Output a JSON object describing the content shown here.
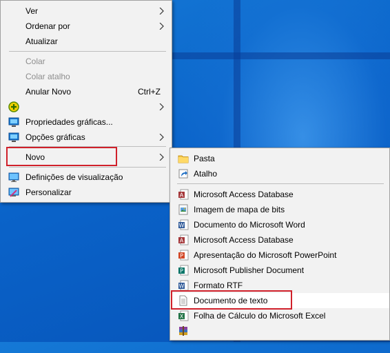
{
  "main_menu": {
    "items": [
      {
        "label": "Ver",
        "has_submenu": true
      },
      {
        "label": "Ordenar por",
        "has_submenu": true
      },
      {
        "label": "Atualizar"
      },
      {
        "label": "Colar",
        "disabled": true
      },
      {
        "label": "Colar atalho",
        "disabled": true
      },
      {
        "label": "Anular Novo",
        "shortcut": "Ctrl+Z"
      },
      {
        "label": "",
        "icon": "graphics-plus-icon",
        "has_submenu": true
      },
      {
        "label": "Propriedades gráficas...",
        "icon": "graphics-properties-icon"
      },
      {
        "label": "Opções gráficas",
        "icon": "graphics-options-icon",
        "has_submenu": true
      },
      {
        "label": "Novo",
        "has_submenu": true,
        "highlighted": true
      },
      {
        "label": "Definições de visualização",
        "icon": "display-icon"
      },
      {
        "label": "Personalizar",
        "icon": "personalize-icon"
      }
    ]
  },
  "sub_menu": {
    "items": [
      {
        "label": "Pasta",
        "icon": "folder-icon"
      },
      {
        "label": "Atalho",
        "icon": "shortcut-icon"
      },
      {
        "label": "Microsoft Access Database",
        "icon": "access-icon"
      },
      {
        "label": "Imagem de mapa de bits",
        "icon": "bitmap-icon"
      },
      {
        "label": "Documento do Microsoft Word",
        "icon": "word-icon"
      },
      {
        "label": "Microsoft Access Database",
        "icon": "access-icon"
      },
      {
        "label": "Apresentação do Microsoft PowerPoint",
        "icon": "powerpoint-icon"
      },
      {
        "label": "Microsoft Publisher Document",
        "icon": "publisher-icon"
      },
      {
        "label": "Formato RTF",
        "icon": "rtf-icon"
      },
      {
        "label": "Documento de texto",
        "icon": "text-document-icon",
        "highlighted": true
      },
      {
        "label": "Folha de Cálculo do Microsoft Excel",
        "icon": "excel-icon"
      },
      {
        "label": "",
        "icon": "winrar-icon"
      }
    ]
  },
  "colors": {
    "highlight_border": "#d0202a",
    "menu_background": "#f2f2f2",
    "desktop_blue": "#0a63c9"
  }
}
